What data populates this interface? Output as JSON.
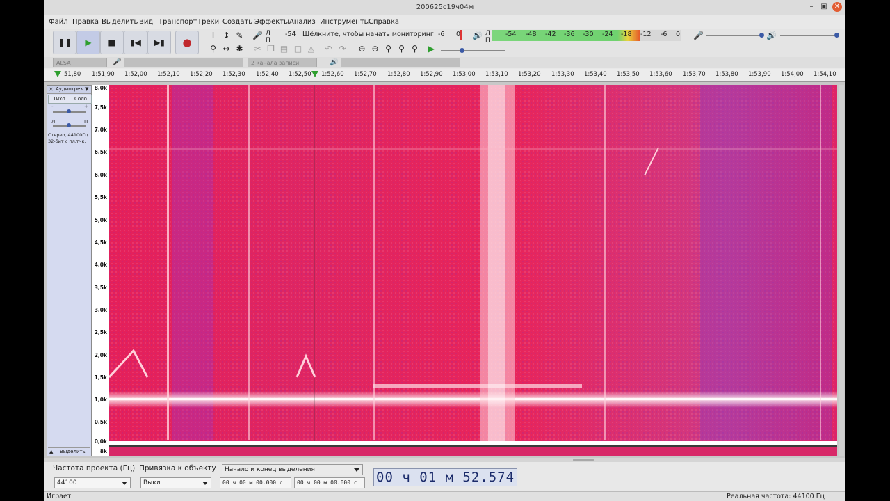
{
  "window": {
    "title": "200625с19ч04м"
  },
  "menu": [
    "Файл",
    "Правка",
    "Выделить",
    "Вид",
    "Транспорт",
    "Треки",
    "Создать",
    "Эффекты",
    "Анализ",
    "Инструменты",
    "Справка"
  ],
  "transport": {
    "pause_icon": "pause-icon",
    "play_icon": "play-icon",
    "stop_icon": "stop-icon",
    "skip_start_icon": "skip-to-start-icon",
    "skip_end_icon": "skip-to-end-icon",
    "record_icon": "record-icon",
    "play_color": "#2e9e2e",
    "record_color": "#c0282d"
  },
  "record_meter": {
    "channels": [
      "Л",
      "П"
    ],
    "level": "-54",
    "monitor_text": "Щёлкните, чтобы начать мониторинг",
    "right_marks": [
      "-6",
      "0"
    ]
  },
  "play_meter": {
    "channels": [
      "Л",
      "П"
    ],
    "ticks": [
      "-54",
      "-48",
      "-42",
      "-36",
      "-30",
      "-24",
      "-18",
      "-12",
      "-6",
      "0"
    ],
    "fill_fraction": 0.78
  },
  "device": {
    "host": "ALSA",
    "channels": "2 канала записи (стерео)"
  },
  "ruler": {
    "ticks": [
      "51,80",
      "1:51,90",
      "1:52,00",
      "1:52,10",
      "1:52,20",
      "1:52,30",
      "1:52,40",
      "1:52,50",
      "1:52,60",
      "1:52,70",
      "1:52,80",
      "1:52,90",
      "1:53,00",
      "1:53,10",
      "1:53,20",
      "1:53,30",
      "1:53,40",
      "1:53,50",
      "1:53,60",
      "1:53,70",
      "1:53,80",
      "1:53,90",
      "1:54,00",
      "1:54,10"
    ]
  },
  "track": {
    "name": "Аудиотрек",
    "mute": "Тихо",
    "solo": "Соло",
    "gain_marks": [
      "-",
      "+"
    ],
    "pan_marks": [
      "Л",
      "П"
    ],
    "info_line1": "Стерео, 44100Гц",
    "info_line2": "32-бит с пл.тчк.",
    "select": "Выделить"
  },
  "freq_axis": [
    "8,0k",
    "7,5k",
    "7,0k",
    "6,5k",
    "6,0k",
    "5,5k",
    "5,0k",
    "4,5k",
    "4,0k",
    "3,5k",
    "3,0k",
    "2,5k",
    "2,0k",
    "1,5k",
    "1,0k",
    "0,5k",
    "0,0k"
  ],
  "second_channel_label": "8k",
  "selection": {
    "rate_label": "Частота проекта (Гц)",
    "rate_value": "44100",
    "snap_label": "Привязка к объекту",
    "snap_value": "Выкл",
    "mode_value": "Начало и конец выделения",
    "start": "00 ч 00 м 00.000 с",
    "end": "00 ч 00 м 00.000 с"
  },
  "position": "00 ч 01 м 52.574 с",
  "status": {
    "left": "Играет",
    "right": "Реальная частота: 44100 Гц"
  }
}
